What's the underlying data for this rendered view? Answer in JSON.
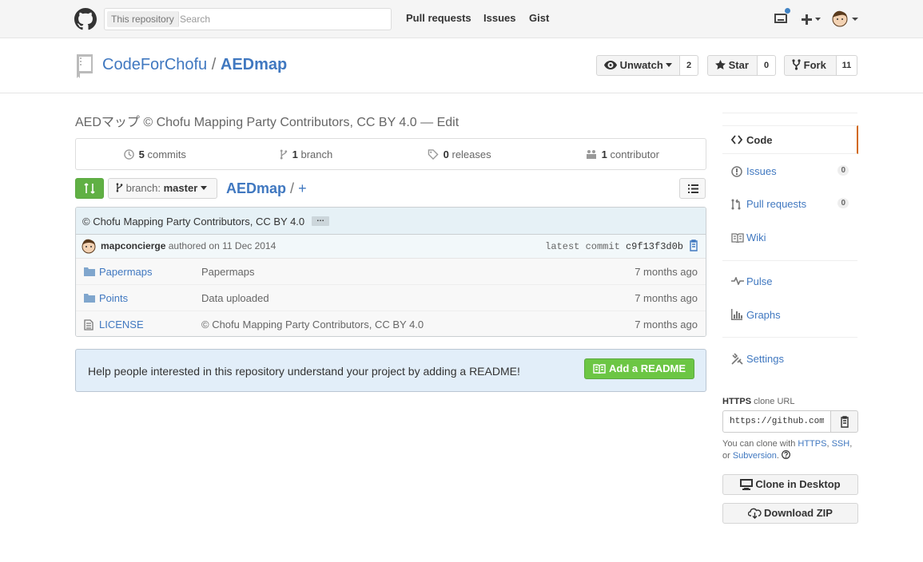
{
  "header": {
    "search_scope": "This repository",
    "search_placeholder": "Search",
    "nav": [
      "Pull requests",
      "Issues",
      "Gist"
    ]
  },
  "repo": {
    "owner": "CodeForChofu",
    "separator": "/",
    "name": "AEDmap",
    "watch_label": "Unwatch",
    "watch_count": "2",
    "star_label": "Star",
    "star_count": "0",
    "fork_label": "Fork",
    "fork_count": "11"
  },
  "description": {
    "text": "AEDマップ © Chofu Mapping Party Contributors, CC BY 4.0",
    "dash": "—",
    "edit": "Edit"
  },
  "numbers": {
    "commits_count": "5",
    "commits_label": "commits",
    "branch_count": "1",
    "branch_label": "branch",
    "releases_count": "0",
    "releases_label": "releases",
    "contributor_count": "1",
    "contributor_label": "contributor"
  },
  "filenav": {
    "branch_prefix": "branch:",
    "branch": "master",
    "crumb_repo": "AEDmap",
    "crumb_slash": "/",
    "crumb_add": "+"
  },
  "commit": {
    "message": "© Chofu Mapping Party Contributors, CC BY 4.0",
    "ellipsis": "…",
    "author": "mapconcierge",
    "authored": "authored on 11 Dec 2014",
    "latest_label": "latest commit",
    "sha": "c9f13f3d0b"
  },
  "files": [
    {
      "type": "folder",
      "name": "Papermaps",
      "message": "Papermaps",
      "age": "7 months ago"
    },
    {
      "type": "folder",
      "name": "Points",
      "message": "Data uploaded",
      "age": "7 months ago"
    },
    {
      "type": "file",
      "name": "LICENSE",
      "message": "© Chofu Mapping Party Contributors, CC BY 4.0",
      "age": "7 months ago"
    }
  ],
  "readme": {
    "text": "Help people interested in this repository understand your project by adding a README!",
    "button": "Add a README"
  },
  "sidebar": {
    "code": "Code",
    "issues": "Issues",
    "issues_count": "0",
    "pulls": "Pull requests",
    "pulls_count": "0",
    "wiki": "Wiki",
    "pulse": "Pulse",
    "graphs": "Graphs",
    "settings": "Settings"
  },
  "clone": {
    "protocol": "HTTPS",
    "label": "clone URL",
    "url": "https://github.com/CodeForChofu/AEDmap.git",
    "help_prefix": "You can clone with",
    "https": "HTTPS",
    "ssh": "SSH",
    "or": "or",
    "subversion": "Subversion",
    "desktop_button": "Clone in Desktop",
    "zip_button": "Download ZIP"
  },
  "colors": {
    "link": "#4078c0",
    "accent_green": "#6cc644",
    "selected_tab": "#d26911"
  }
}
